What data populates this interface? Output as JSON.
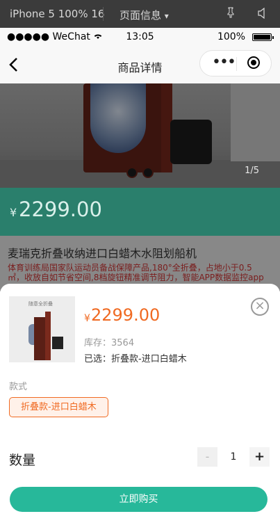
{
  "simulator": {
    "device_label": "iPhone 5 100% 16",
    "page_info_label": "页面信息",
    "page_info_caret": "▾",
    "pin_icon": "pin-icon",
    "volume_icon": "volume-icon"
  },
  "status_bar": {
    "signal": "●●●●● WeChat",
    "time": "13:05",
    "battery_percent": "100%"
  },
  "navbar": {
    "title": "商品详情",
    "back_icon": "chevron-left-icon",
    "more_glyph": "•••",
    "capsule_icons": [
      "more-icon",
      "record-icon"
    ]
  },
  "product": {
    "image_counter": "1/5",
    "currency": "¥",
    "price": "2299.00",
    "name": "麦瑞克折叠收纳进口白蜡木水阻划船机",
    "description": "体育训练局国家队运动员备战保障产品,180°全折叠，占地小于0.5㎡，收放自如节省空间,8档旋钮精准调节阻力，智能APP数据监控app"
  },
  "sheet": {
    "close_glyph": "×",
    "thumb_caption": "随意全折叠",
    "currency": "¥",
    "price": "2299.00",
    "stock": "库存：3564",
    "selected": "已选：折叠款-进口白蜡木",
    "spec_label": "款式",
    "spec_options": [
      "折叠款-进口白蜡木"
    ],
    "quantity_label": "数量",
    "quantity": "1",
    "minus": "-",
    "plus": "+",
    "buy_label": "立即购买"
  },
  "colors": {
    "accent_green": "#27b89a",
    "price_orange": "#f06a22",
    "band_green": "#2a7f6c"
  }
}
